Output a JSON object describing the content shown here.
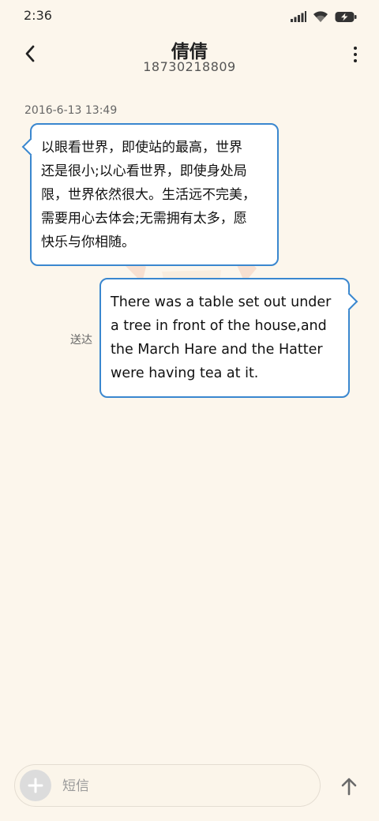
{
  "status_bar": {
    "time": "2:36",
    "icons": [
      "signal-icon",
      "wifi-icon",
      "battery-charging-icon"
    ]
  },
  "header": {
    "contact_name": "倩倩",
    "contact_number": "18730218809",
    "icons": [
      "back-arrow-icon",
      "more-vertical-icon"
    ]
  },
  "conversation": {
    "timestamp": "2016-6-13 13:49",
    "messages": [
      {
        "direction": "incoming",
        "text": "以眼看世界，即使站的最高，世界\n还是很小;以心看世界，即使身处局\n限，世界依然很大。生活远不完美，\n需要用心去体会;无需拥有太多，愿\n快乐与你相随。"
      },
      {
        "direction": "outgoing",
        "text": "There was a table set out under\na tree in front of the house,and\nthe March Hare and the Hatter\nwere having tea at it.",
        "status": "送达"
      }
    ]
  },
  "composer": {
    "placeholder": "短信",
    "value": "",
    "icons": [
      "plus-icon",
      "send-arrow-icon"
    ]
  },
  "colors": {
    "background": "#fcf6ec",
    "bubble_border": "#3a87cf",
    "bubble_fill": "#ffffff"
  }
}
